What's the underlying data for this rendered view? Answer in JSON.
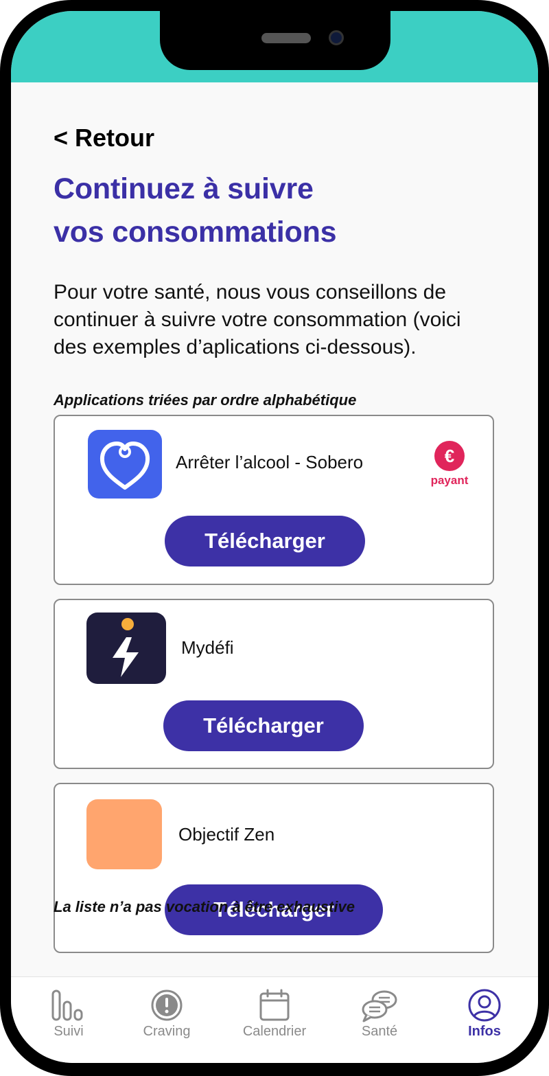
{
  "header": {
    "back_label": "< Retour",
    "title_line1": "Continuez à suivre",
    "title_line2": "vos consommations",
    "intro": "Pour votre santé, nous vous conseillons de continuer à suivre votre consommation (voici des exemples d’aplications ci-dessous).",
    "sort_note": "Applications triées par ordre alphabétique"
  },
  "apps": [
    {
      "name": "Arrêter l’alcool - Sobero",
      "button_label": "Télécharger",
      "badge_symbol": "€",
      "badge_label": "payant",
      "icon": "heart-icon",
      "icon_color": "#4263eb"
    },
    {
      "name": "Mydéfi",
      "button_label": "Télécharger",
      "icon": "lightning-icon",
      "icon_color": "#1f1d3d"
    },
    {
      "name": "Objectif Zen",
      "button_label": "Télécharger",
      "icon": "blank-app-icon",
      "icon_color": "#ffa56e"
    }
  ],
  "cut_text": "La liste n’a pas vocation à être exhaustive",
  "tab_bar": {
    "items": [
      {
        "label": "Suivi",
        "icon": "bar-chart-icon"
      },
      {
        "label": "Craving",
        "icon": "alert-icon"
      },
      {
        "label": "Calendrier",
        "icon": "calendar-icon"
      },
      {
        "label": "Santé",
        "icon": "chat-bubbles-icon"
      },
      {
        "label": "Infos",
        "icon": "user-icon",
        "active": true
      }
    ]
  },
  "colors": {
    "status_bar": "#3ccfc3",
    "primary": "#3d31a6",
    "title": "#3b30a6",
    "paid": "#e0255b",
    "inactive": "#8a8a8a"
  }
}
